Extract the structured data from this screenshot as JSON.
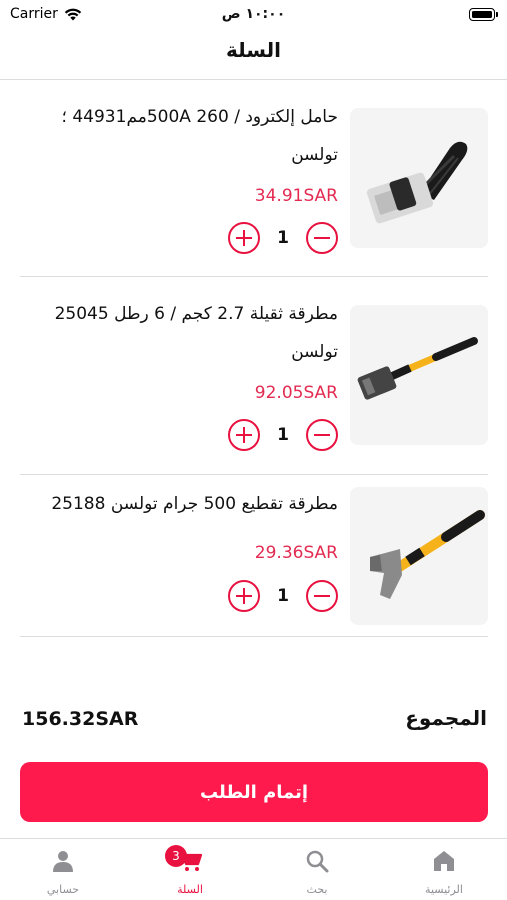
{
  "status_bar": {
    "carrier": "Carrier",
    "time": "١٠:٠٠ ص"
  },
  "header": {
    "title": "السلة"
  },
  "cart": {
    "items": [
      {
        "name": "حامل إلكترود / 500A 260مم44931 ؛ تولسن",
        "price": "34.91SAR",
        "quantity": "1",
        "image_icon": "electrode-holder-icon"
      },
      {
        "name": "مطرقة ثقيلة 2.7 كجم / 6 رطل 25045 تولسن",
        "price": "92.05SAR",
        "quantity": "1",
        "image_icon": "sledgehammer-icon"
      },
      {
        "name": "مطرقة تقطيع 500 جرام تولسن 25188",
        "price": "29.36SAR",
        "quantity": "1",
        "image_icon": "cutting-hammer-icon"
      }
    ]
  },
  "summary": {
    "total_label": "المجموع",
    "total_value": "156.32SAR"
  },
  "checkout": {
    "label": "إتمام الطلب"
  },
  "tab_bar": {
    "tabs": [
      {
        "label": "الرئيسية",
        "icon": "home-icon"
      },
      {
        "label": "بحث",
        "icon": "search-icon"
      },
      {
        "label": "السلة",
        "icon": "cart-icon",
        "badge": "3",
        "active": true
      },
      {
        "label": "حسابي",
        "icon": "person-icon"
      }
    ]
  },
  "colors": {
    "accent": "#e8113f",
    "button": "#ff1a4e",
    "price": "#e32b52",
    "muted": "#8e8e93"
  }
}
